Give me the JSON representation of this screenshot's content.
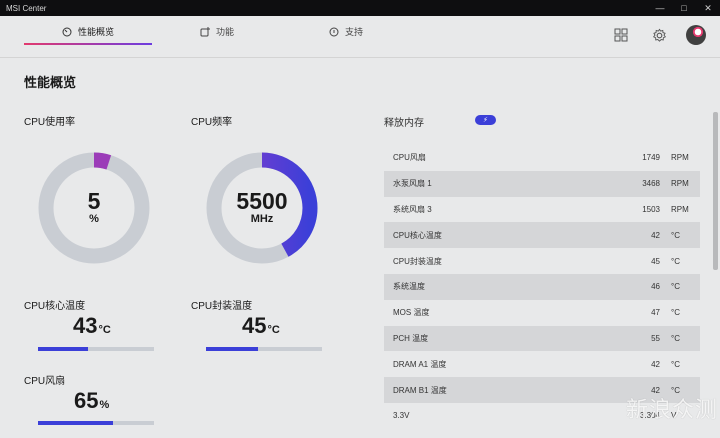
{
  "window": {
    "title": "MSI Center"
  },
  "nav": {
    "tabs": [
      {
        "label": "性能概览",
        "active": true,
        "icon": "gauge-icon"
      },
      {
        "label": "功能",
        "active": false,
        "icon": "add-feature-icon"
      },
      {
        "label": "支持",
        "active": false,
        "icon": "chat-support-icon"
      }
    ],
    "actions": [
      "grid-icon",
      "gear-icon",
      "avatar"
    ]
  },
  "page_title": "性能概览",
  "cpu_usage": {
    "label": "CPU使用率",
    "value": "5",
    "unit": "%",
    "fraction": 0.05
  },
  "cpu_freq": {
    "label": "CPU频率",
    "value": "5500",
    "unit": "MHz",
    "fraction": 0.42
  },
  "cpu_core_temp": {
    "label": "CPU核心温度",
    "value": "43",
    "unit": "°C",
    "fraction": 0.43
  },
  "cpu_pkg_temp": {
    "label": "CPU封装温度",
    "value": "45",
    "unit": "°C",
    "fraction": 0.45
  },
  "cpu_fan": {
    "label": "CPU风扇",
    "value": "65",
    "unit": "%",
    "fraction": 0.65
  },
  "memory": {
    "label": "释放内存",
    "button_icon": "lightning-icon"
  },
  "sensors": [
    {
      "name": "CPU风扇",
      "value": "1749",
      "unit": "RPM"
    },
    {
      "name": "水泵风扇 1",
      "value": "3468",
      "unit": "RPM"
    },
    {
      "name": "系统风扇 3",
      "value": "1503",
      "unit": "RPM"
    },
    {
      "name": "CPU核心温度",
      "value": "42",
      "unit": "°C"
    },
    {
      "name": "CPU封装温度",
      "value": "45",
      "unit": "°C"
    },
    {
      "name": "系统温度",
      "value": "46",
      "unit": "°C"
    },
    {
      "name": "MOS 温度",
      "value": "47",
      "unit": "°C"
    },
    {
      "name": "PCH 温度",
      "value": "55",
      "unit": "°C"
    },
    {
      "name": "DRAM A1 温度",
      "value": "42",
      "unit": "°C"
    },
    {
      "name": "DRAM B1 温度",
      "value": "42",
      "unit": "°C"
    },
    {
      "name": "3.3V",
      "value": "3.304",
      "unit": "V"
    }
  ],
  "colors": {
    "accent": "#3b3fd8",
    "accent_pink": "#e23a6e",
    "track": "#c9cdd3"
  },
  "watermark": "新浪众测"
}
